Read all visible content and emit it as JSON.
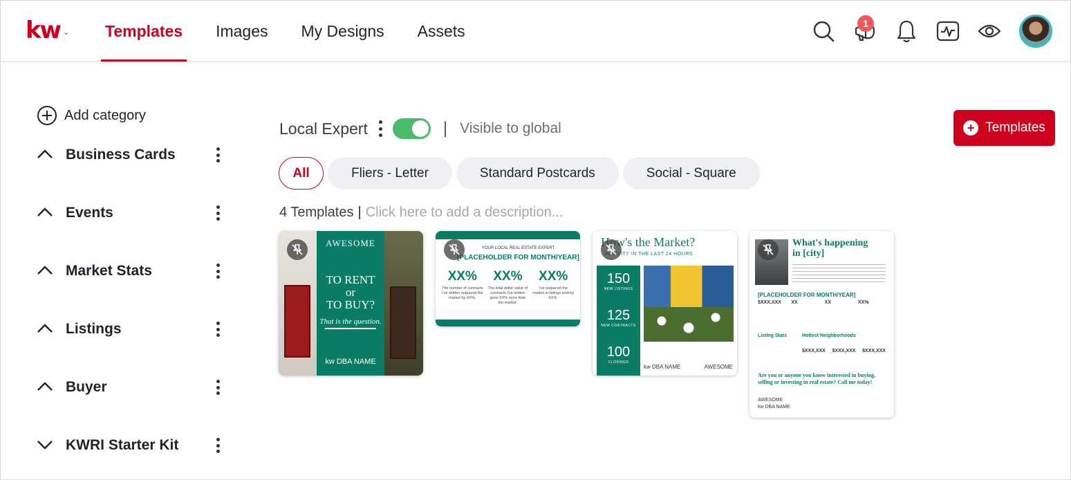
{
  "header": {
    "logo_text": "kw",
    "logo_caret": "⌄",
    "tabs": [
      "Templates",
      "Images",
      "My Designs",
      "Assets"
    ],
    "active_tab": "Templates",
    "notification_badge": "1",
    "icons": [
      "search-icon",
      "megaphone-icon",
      "bell-icon",
      "activity-monitor-icon",
      "eye-icon",
      "avatar"
    ]
  },
  "sidebar": {
    "add_category_label": "Add category",
    "categories": [
      {
        "label": "Business Cards",
        "expanded": true
      },
      {
        "label": "Events",
        "expanded": true
      },
      {
        "label": "Market Stats",
        "expanded": true
      },
      {
        "label": "Listings",
        "expanded": true
      },
      {
        "label": "Buyer",
        "expanded": true
      },
      {
        "label": "KWRI Starter Kit",
        "expanded": false
      }
    ]
  },
  "collection": {
    "name": "Local Expert",
    "visible_toggle_on": true,
    "visible_label": "Visible to global",
    "add_button_label": "Templates",
    "filters": [
      "All",
      "Fliers - Letter",
      "Standard Postcards",
      "Social - Square"
    ],
    "active_filter": "All",
    "count_label": "4 Templates",
    "description_placeholder": "Click here to add a description..."
  },
  "cards": {
    "card1": {
      "brand": "AWESOME",
      "headline_1": "TO RENT",
      "headline_2": "or",
      "headline_3": "TO BUY?",
      "tagline": "That is the question.",
      "dba": "kw DBA NAME"
    },
    "card2": {
      "kicker": "YOUR LOCAL REAL ESTATE EXPERT",
      "title": "[PLACEHOLDER FOR MONTH/YEAR]",
      "stats": [
        {
          "value": "XX%",
          "caption": "The number of contracts I've written outpaced the market by XX%."
        },
        {
          "value": "XX%",
          "caption": "The total dollar value of contracts I've written grew XX% more than the market."
        },
        {
          "value": "XX%",
          "caption": "I've outpaced the market in listings sold by XX%."
        }
      ]
    },
    "card3": {
      "title": "How's the Market?",
      "subtitle": "ACTIVITY IN THE LAST 24 HOURS",
      "stats": [
        {
          "value": "150",
          "label": "NEW LISTINGS"
        },
        {
          "value": "125",
          "label": "NEW CONTRACTS"
        },
        {
          "value": "100",
          "label": "CLOSINGS"
        }
      ],
      "dba": "kw DBA NAME",
      "brand": "AWESOME"
    },
    "card4": {
      "title_1": "What's happening",
      "title_2": "in [city]",
      "placeholder": "[PLACEHOLDER FOR MONTH/YEAR]",
      "grid": [
        "$XXX,XXX",
        "XX",
        "XX",
        "XX%"
      ],
      "listing_stats": "Listing Stats",
      "hottest": "Hottest Neighborhoods",
      "values": [
        "$XXX,XXX",
        "$XXX,XXX",
        "$XXX,XXX"
      ],
      "cta": "Are you or anyone you know interested in buying, selling or investing in real estate? Call me today!",
      "brand": "AWESOME",
      "dba": "kw DBA NAME"
    }
  },
  "colors": {
    "brand_red": "#ce011f",
    "teal": "#0a7c66",
    "toggle_green": "#4cba6b"
  }
}
